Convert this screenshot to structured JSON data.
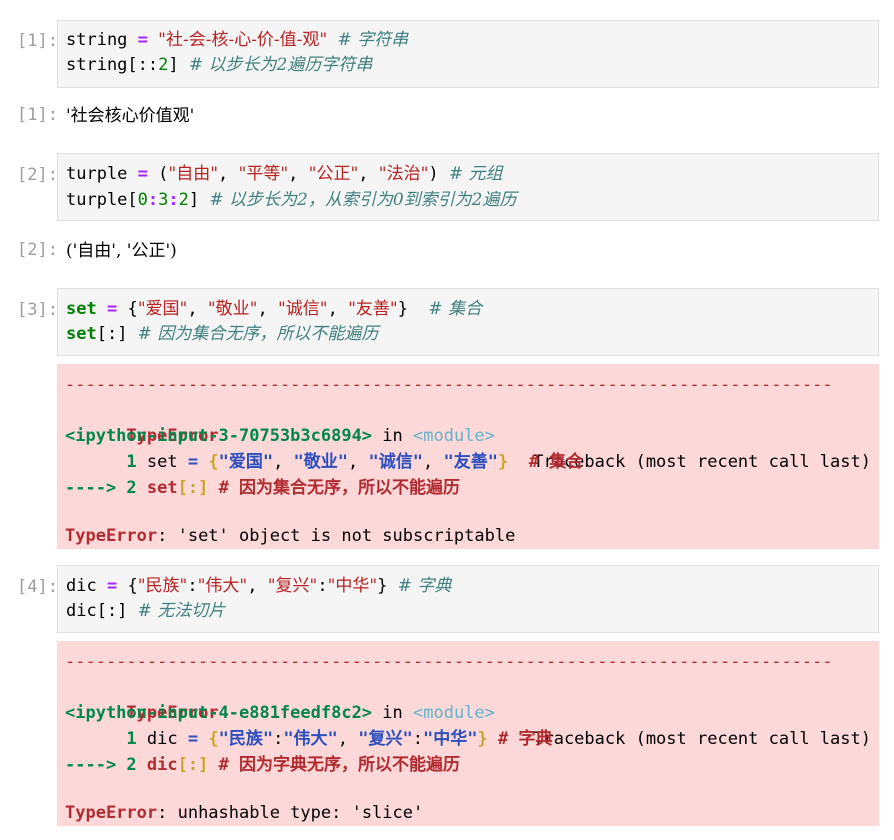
{
  "cells": [
    {
      "prompt": "[1]:",
      "input": {
        "l1": {
          "a": "string",
          "b": " = ",
          "c": "\"社-会-核-心-价-值-观\"",
          "d": " ",
          "e": "# 字符串"
        },
        "l2": {
          "a": "string[::",
          "b": "2",
          "c": "] ",
          "d": "# 以步长为2遍历字符串"
        }
      },
      "output_prompt": "[1]:",
      "output": "'社会核心价值观'"
    },
    {
      "prompt": "[2]:",
      "input": {
        "l1": {
          "a": "turple",
          "b": " = ",
          "c": "(",
          "d": "\"自由\"",
          "e": ", ",
          "f": "\"平等\"",
          "g": ", ",
          "h": "\"公正\"",
          "i": ", ",
          "j": "\"法治\"",
          "k": ") ",
          "l": "# 元组"
        },
        "l2": {
          "a": "turple[",
          "b": "0",
          "c": ":",
          "d": "3",
          "e": ":",
          "f": "2",
          "g": "] ",
          "h": "# 以步长为2，从索引为0到索引为2遍历"
        }
      },
      "output_prompt": "[2]:",
      "output": "('自由', '公正')"
    },
    {
      "prompt": "[3]:",
      "input": {
        "l1": {
          "a": "set",
          "b": " = ",
          "c": "{",
          "d": "\"爱国\"",
          "e": ", ",
          "f": "\"敬业\"",
          "g": ", ",
          "h": "\"诚信\"",
          "i": ", ",
          "j": "\"友善\"",
          "k": "}  ",
          "l": "# 集合"
        },
        "l2": {
          "a": "set",
          "b": "[:] ",
          "c": "# 因为集合无序，所以不能遍历"
        }
      },
      "error": {
        "dashes": "---------------------------------------------------------------------------",
        "etype": "TypeError",
        "traceback_label": "Traceback (most recent call last)",
        "input_ref": "<ipython-input-3-70753b3c6894>",
        "in_word": " in ",
        "module": "<module>",
        "line1": {
          "num": "      1 ",
          "a": "set ",
          "b": "= ",
          "c": "{",
          "d": "\"爱国\"",
          "e": ", ",
          "f": "\"敬业\"",
          "g": ", ",
          "h": "\"诚信\"",
          "i": ", ",
          "j": "\"友善\"",
          "k": "}",
          "l": "  # 集合"
        },
        "line2": {
          "arrow": "----> 2 ",
          "a": "set",
          "b": "[:]",
          "c": " # 因为集合无序，所以不能遍历"
        },
        "message_type": "TypeError",
        "message": ": 'set' object is not subscriptable"
      }
    },
    {
      "prompt": "[4]:",
      "input": {
        "l1": {
          "a": "dic",
          "b": " = ",
          "c": "{",
          "d": "\"民族\"",
          "e": ":",
          "f": "\"伟大\"",
          "g": ", ",
          "h": "\"复兴\"",
          "i": ":",
          "j": "\"中华\"",
          "k": "} ",
          "l": "# 字典"
        },
        "l2": {
          "a": "dic[:] ",
          "b": "# 无法切片"
        }
      },
      "error": {
        "dashes": "---------------------------------------------------------------------------",
        "etype": "TypeError",
        "traceback_label": "Traceback (most recent call last)",
        "input_ref": "<ipython-input-4-e881feedf8c2>",
        "in_word": " in ",
        "module": "<module>",
        "line1": {
          "num": "      1 ",
          "a": "dic ",
          "b": "= ",
          "c": "{",
          "d": "\"民族\"",
          "e": ":",
          "f": "\"伟大\"",
          "g": ", ",
          "h": "\"复兴\"",
          "i": ":",
          "j": "\"中华\"",
          "k": "}",
          "l": " # 字典"
        },
        "line2": {
          "arrow": "----> 2 ",
          "a": "dic",
          "b": "[:]",
          "c": " # 因为字典无序，所以不能遍历"
        },
        "message_type": "TypeError",
        "message": ": unhashable type: 'slice'"
      }
    }
  ]
}
